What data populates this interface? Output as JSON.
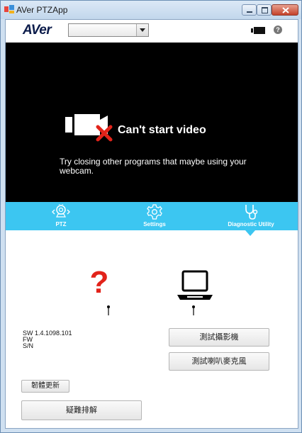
{
  "window": {
    "title": "AVer PTZApp"
  },
  "toolbar": {
    "logo": "AVer",
    "camera_select": {
      "value": ""
    },
    "help": "?"
  },
  "video": {
    "error_title": "Can't start video",
    "error_message": "Try closing other programs that maybe using your webcam."
  },
  "tabs": [
    {
      "label": "PTZ",
      "icon": "ptz-icon"
    },
    {
      "label": "Settings",
      "icon": "gear-icon"
    },
    {
      "label": "Diagnostic Utility",
      "icon": "stethoscope-icon",
      "active": true
    }
  ],
  "diagnostic": {
    "unknown_symbol": "?",
    "sw": "SW 1.4.1098.101",
    "fw": "FW",
    "sn": "S/N",
    "test_camera_label": "測試攝影機",
    "test_audio_label": "測試喇叭麥克風",
    "firmware_update_label": "韌體更新",
    "troubleshoot_label": "疑難排解"
  },
  "colors": {
    "accent": "#3cc6f1",
    "error": "#e2231a",
    "video_bg": "#000000"
  }
}
